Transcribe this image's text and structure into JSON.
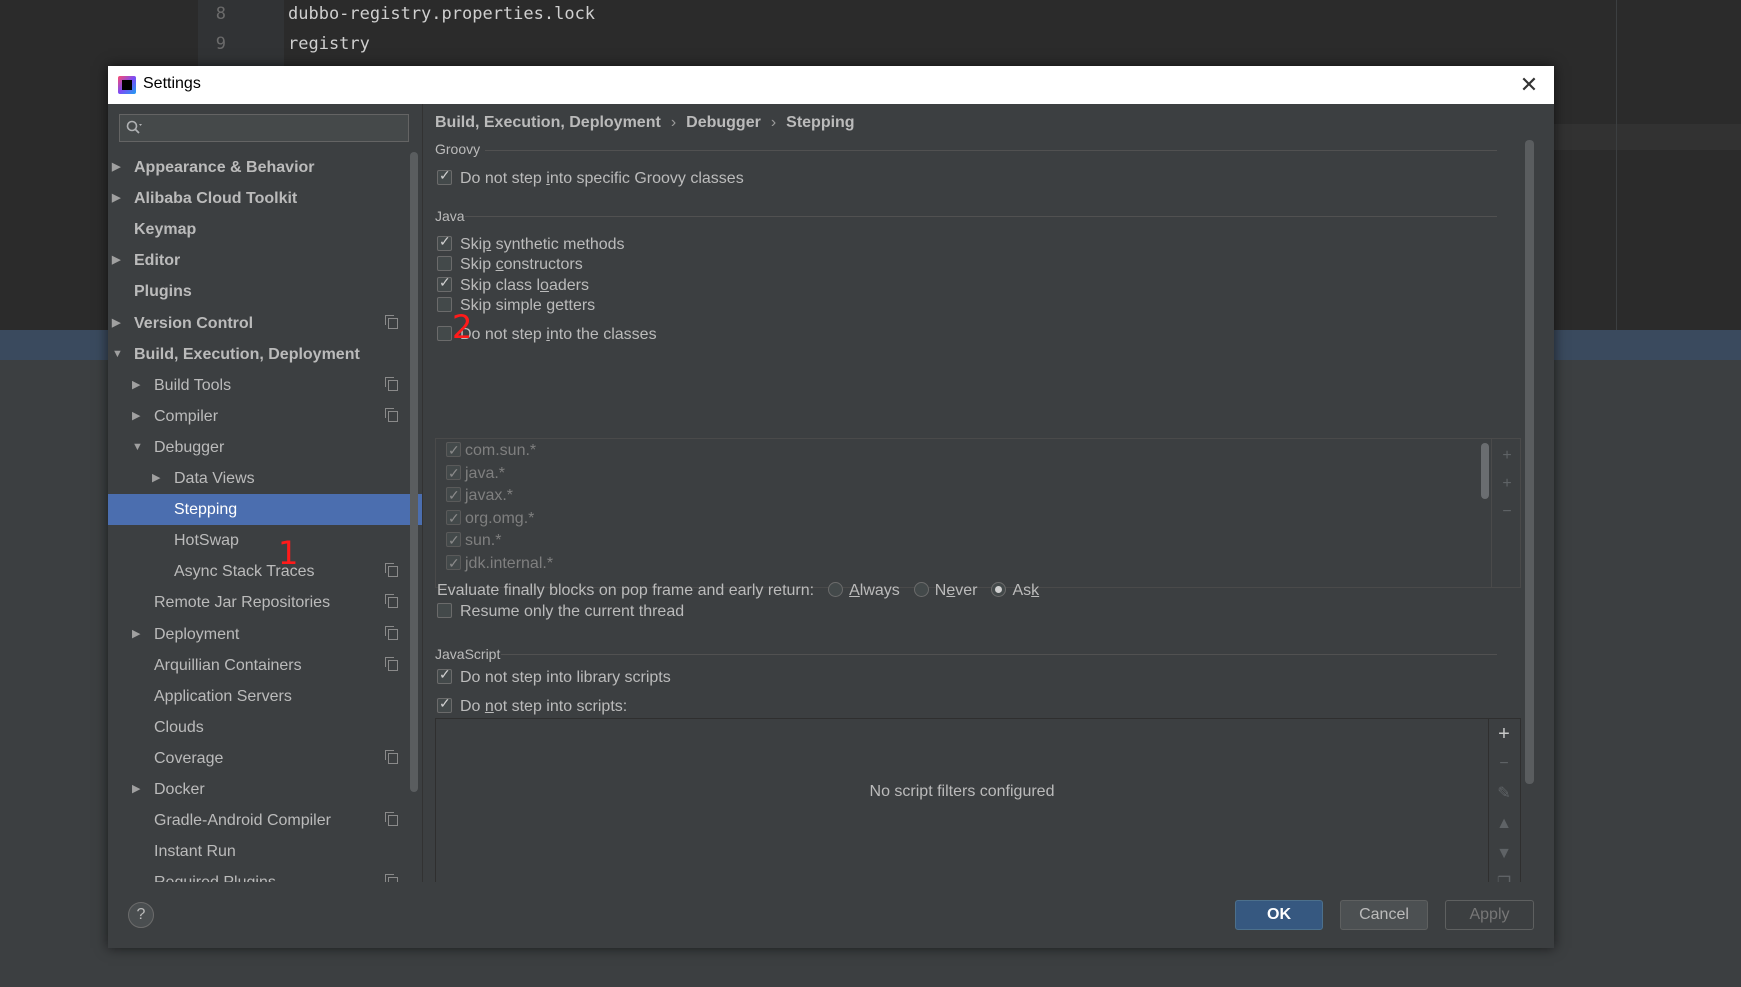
{
  "background_editor": {
    "lines": [
      {
        "num": "8",
        "text": "dubbo-registry.properties.lock"
      },
      {
        "num": "9",
        "text": "registry"
      }
    ]
  },
  "dialog": {
    "title": "Settings",
    "close_glyph": "✕"
  },
  "search": {
    "icon": "search-icon"
  },
  "tree": [
    {
      "label": "Appearance & Behavior",
      "bold": true,
      "arrow": "right",
      "level": 0
    },
    {
      "label": "Alibaba Cloud Toolkit",
      "bold": true,
      "arrow": "right",
      "level": 0
    },
    {
      "label": "Keymap",
      "bold": true,
      "arrow": "",
      "level": 0
    },
    {
      "label": "Editor",
      "bold": true,
      "arrow": "right",
      "level": 0
    },
    {
      "label": "Plugins",
      "bold": true,
      "arrow": "",
      "level": 0
    },
    {
      "label": "Version Control",
      "bold": true,
      "arrow": "right",
      "level": 0,
      "project_icon": true
    },
    {
      "label": "Build, Execution, Deployment",
      "bold": true,
      "arrow": "down",
      "level": 0
    },
    {
      "label": "Build Tools",
      "arrow": "right",
      "level": 1,
      "project_icon": true
    },
    {
      "label": "Compiler",
      "arrow": "right",
      "level": 1,
      "project_icon": true
    },
    {
      "label": "Debugger",
      "arrow": "down",
      "level": 1
    },
    {
      "label": "Data Views",
      "arrow": "right",
      "level": 2
    },
    {
      "label": "Stepping",
      "arrow": "",
      "level": 2,
      "selected": true
    },
    {
      "label": "HotSwap",
      "arrow": "",
      "level": 2
    },
    {
      "label": "Async Stack Traces",
      "arrow": "",
      "level": 2,
      "project_icon": true
    },
    {
      "label": "Remote Jar Repositories",
      "arrow": "",
      "level": 1,
      "project_icon": true
    },
    {
      "label": "Deployment",
      "arrow": "right",
      "level": 1,
      "project_icon": true
    },
    {
      "label": "Arquillian Containers",
      "arrow": "",
      "level": 1,
      "project_icon": true
    },
    {
      "label": "Application Servers",
      "arrow": "",
      "level": 1
    },
    {
      "label": "Clouds",
      "arrow": "",
      "level": 1
    },
    {
      "label": "Coverage",
      "arrow": "",
      "level": 1,
      "project_icon": true
    },
    {
      "label": "Docker",
      "arrow": "right",
      "level": 1
    },
    {
      "label": "Gradle-Android Compiler",
      "arrow": "",
      "level": 1,
      "project_icon": true
    },
    {
      "label": "Instant Run",
      "arrow": "",
      "level": 1
    },
    {
      "label": "Required Plugins",
      "arrow": "",
      "level": 1,
      "project_icon": true
    }
  ],
  "annotations": {
    "one": "1",
    "two": "2"
  },
  "breadcrumb": {
    "part1": "Build, Execution, Deployment",
    "part2": "Debugger",
    "part3": "Stepping",
    "separator": "›"
  },
  "groovy": {
    "title": "Groovy",
    "skip_groovy_pre": "Do not step ",
    "skip_groovy_mn": "i",
    "skip_groovy_post": "nto specific Groovy classes",
    "skip_groovy_checked": true
  },
  "java": {
    "title": "Java",
    "options": [
      {
        "pre": "Ski",
        "mn": "p",
        "post": " synthetic methods",
        "checked": true
      },
      {
        "pre": "Skip ",
        "mn": "c",
        "post": "onstructors",
        "checked": false
      },
      {
        "pre": "Skip class l",
        "mn": "o",
        "post": "aders",
        "checked": true
      },
      {
        "pre": "Skip simple ",
        "mn": "g",
        "post": "etters",
        "checked": false
      }
    ],
    "classes_label_pre": "Do not step ",
    "classes_label_mn": "i",
    "classes_label_post": "nto the classes",
    "classes_checked": false,
    "classes": [
      "com.sun.*",
      "java.*",
      "javax.*",
      "org.omg.*",
      "sun.*",
      "jdk.internal.*"
    ],
    "classes_tools": [
      "add-class-icon",
      "add-pattern-icon",
      "remove-icon"
    ],
    "eval_label": "Evaluate finally blocks on pop frame and early return:",
    "eval_options": [
      {
        "pre": "",
        "mn": "A",
        "post": "lways",
        "selected": false
      },
      {
        "pre": "N",
        "mn": "e",
        "post": "ver",
        "selected": false
      },
      {
        "pre": "As",
        "mn": "k",
        "post": "",
        "selected": true
      }
    ],
    "resume_label": "Resume only the current thread",
    "resume_checked": false
  },
  "javascript": {
    "title": "JavaScript",
    "library_label": "Do not step into library scripts",
    "library_checked": true,
    "scripts_pre": "Do ",
    "scripts_mn": "n",
    "scripts_post": "ot step into scripts:",
    "scripts_checked": true,
    "empty_text": "No script filters configured",
    "tools": [
      "add-icon",
      "remove-icon",
      "edit-icon",
      "move-up-icon",
      "move-down-icon",
      "copy-icon"
    ]
  },
  "footer": {
    "help": "?",
    "ok": "OK",
    "cancel": "Cancel",
    "apply": "Apply"
  },
  "colors": {
    "selection": "#4b6eaf",
    "ok_button": "#365880",
    "annotation": "#ff1a1a"
  }
}
